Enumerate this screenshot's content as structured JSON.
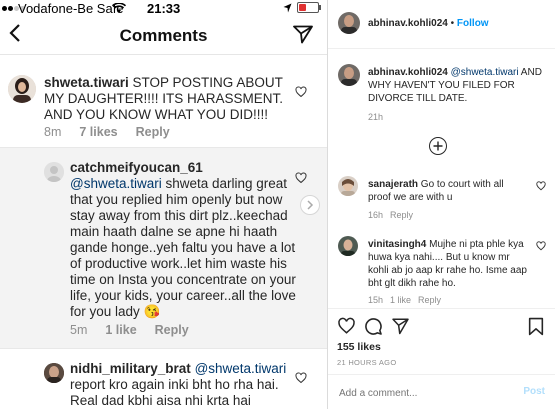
{
  "status_bar": {
    "carrier": "Vodafone-Be Safe",
    "time": "21:33"
  },
  "header": {
    "title": "Comments"
  },
  "comments": [
    {
      "user": "shweta.tiwari",
      "text": " STOP POSTING ABOUT MY DAUGHTER!!!! ITS HARASSMENT. AND YOU KNOW WHAT YOU DID!!!!",
      "age": "8m",
      "likes": "7 likes",
      "reply": "Reply"
    },
    {
      "user": "catchmeifyoucan_61",
      "mention": "@shweta.tiwari",
      "text": " shweta darling great that you replied him openly but now stay away from this dirt plz..keechad main haath dalne se apne hi haath gande honge..yeh faltu you have a lot of productive work..let him waste his time on Insta you concentrate on your life, your kids, your career..all the love for you lady 😘",
      "age": "5m",
      "likes": "1 like",
      "reply": "Reply"
    },
    {
      "user": "nidhi_military_brat",
      "mention": "@shweta.tiwari",
      "text": " report kro again inki bht ho rha hai. Real dad kbhi aisa nhi krta hai concrete hona ke bd bi bhi sica nhi"
    }
  ],
  "post": {
    "author": "abhinav.kohli024",
    "follow_sep": "•",
    "follow": "Follow",
    "caption_user": "abhinav.kohli024",
    "caption_mention": "@shweta.tiwari",
    "caption_text": " AND WHY HAVEN'T YOU FILED FOR DIVORCE TILL DATE.",
    "caption_age": "21h",
    "comments": [
      {
        "user": "sanajerath",
        "text": " Go to court with all proof we are with u",
        "age": "16h",
        "reply": "Reply"
      },
      {
        "user": "vinitasingh4",
        "text": " Mujhe ni pta phle kya huwa kya nahi.... But u know mr kohli ab jo aap kr rahe ho. Isme aap bht glt dikh rahe ho.",
        "age": "15h",
        "likes": "1 like",
        "reply": "Reply"
      }
    ],
    "like_count": "155 likes",
    "timestamp": "21 HOURS AGO",
    "add_comment_placeholder": "Add a comment...",
    "post_button": "Post"
  },
  "colors": {
    "link": "#00376b",
    "follow": "#0095f6",
    "meta": "#8e8e8e"
  },
  "icons": [
    "back-chevron-icon",
    "send-icon",
    "heart-icon",
    "comment-icon",
    "share-icon",
    "bookmark-icon",
    "add-more-icon",
    "wifi-icon",
    "battery-icon",
    "location-icon",
    "chevron-right-icon"
  ]
}
